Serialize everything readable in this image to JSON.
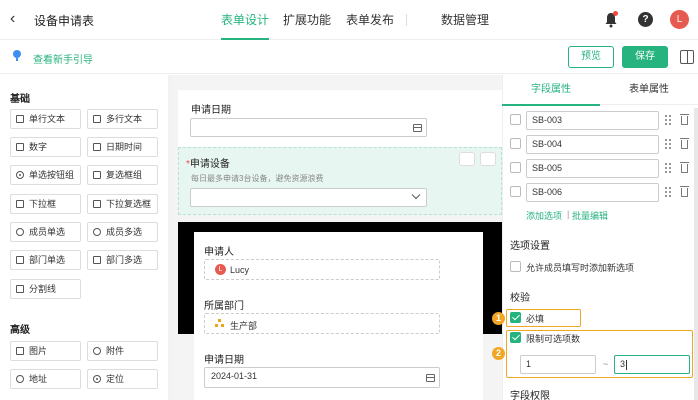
{
  "header": {
    "back_icon": "chevron-left-icon",
    "title": "设备申请表",
    "nav": [
      {
        "label": "表单设计",
        "active": true
      },
      {
        "label": "扩展功能",
        "active": false
      },
      {
        "label": "表单发布",
        "active": false
      },
      {
        "label": "数据管理",
        "active": false
      }
    ],
    "help_label": "?",
    "avatar_letter": "L"
  },
  "toolbar": {
    "guide_label": "查看新手引导",
    "preview_label": "预览",
    "save_label": "保存"
  },
  "left_panel": {
    "basic_title": "基础",
    "basic_items": [
      "单行文本",
      "多行文本",
      "数字",
      "日期时间",
      "单选按钮组",
      "复选框组",
      "下拉框",
      "下拉复选框",
      "成员单选",
      "成员多选",
      "部门单选",
      "部门多选",
      "分割线"
    ],
    "advanced_title": "高级",
    "advanced_items": [
      "图片",
      "附件",
      "地址",
      "定位"
    ]
  },
  "canvas": {
    "field1_label": "申请日期",
    "field2_label": "申请设备",
    "field2_required": "*",
    "field2_hint": "每日最多申请3台设备，避免资源浪费",
    "popup": {
      "applicant_label": "申请人",
      "applicant_avatar": "L",
      "applicant_value": "Lucy",
      "dept_label": "所属部门",
      "dept_value": "生产部",
      "date_label": "申请日期",
      "date_value": "2024-01-31"
    }
  },
  "right_panel": {
    "tabs": [
      {
        "label": "字段属性",
        "active": true
      },
      {
        "label": "表单属性",
        "active": false
      }
    ],
    "options": [
      "SB-003",
      "SB-004",
      "SB-005",
      "SB-006"
    ],
    "add_option_link": "添加选项",
    "separator": "|",
    "batch_edit_link": "批量编辑",
    "option_settings_title": "选项设置",
    "allow_add_label": "允许成员填写时添加新选项",
    "validation_title": "校验",
    "required_label": "必填",
    "limit_label": "限制可选项数",
    "badge1": "1",
    "badge2": "2",
    "min_value": "1",
    "tilde": "~",
    "max_value": "3",
    "permission_title": "字段权限"
  },
  "colors": {
    "accent": "#26b37f",
    "highlight": "#f3a624",
    "danger": "#f5483b"
  }
}
